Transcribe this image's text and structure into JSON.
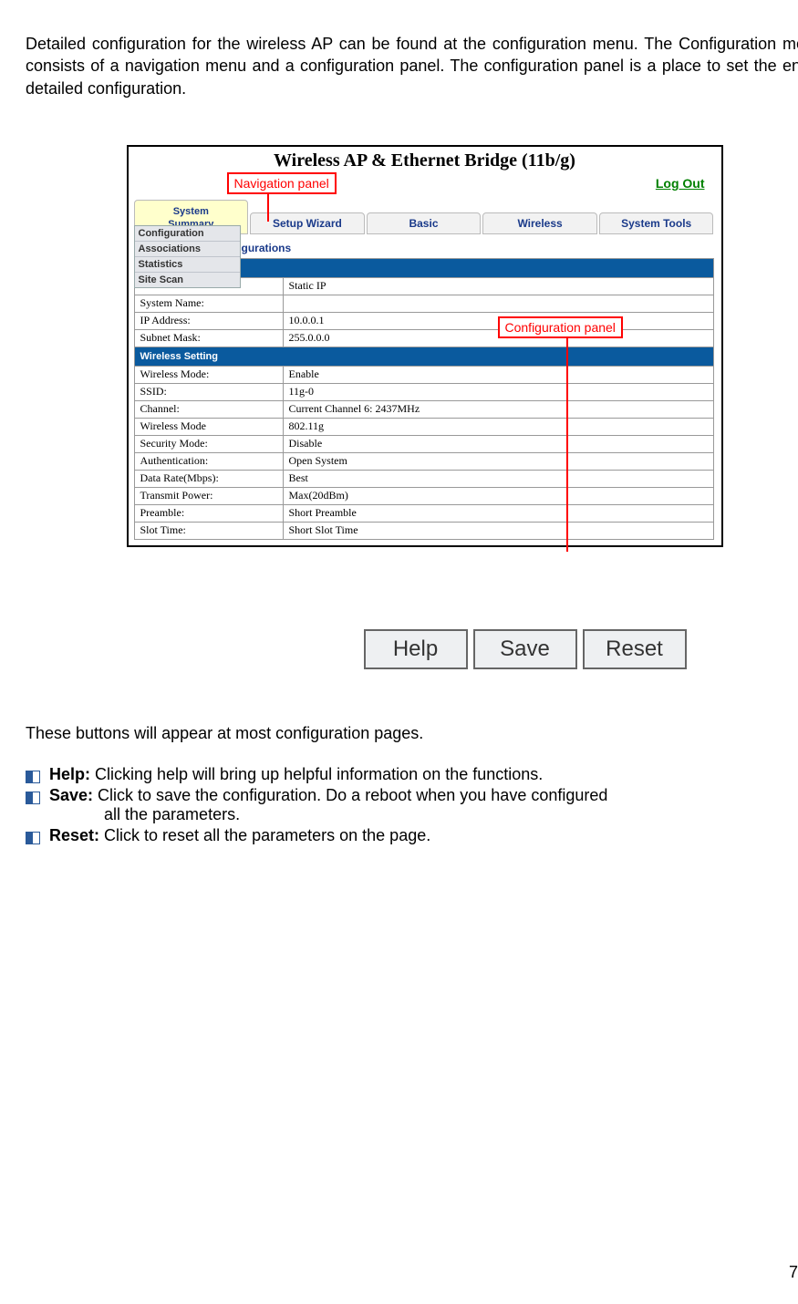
{
  "intro": "Detailed configuration for the wireless AP can be found at the configuration menu. The Configuration menu consists of a navigation menu and a configuration panel. The configuration panel is a place to set the entire detailed configuration.",
  "screenshot": {
    "title": "Wireless AP & Ethernet Bridge (11b/g)",
    "logout": "Log Out",
    "nav_annotation": "Navigation panel",
    "config_annotation": "Configuration panel",
    "tabs": {
      "t0a": "System",
      "t0b": "Summary",
      "t1": "Setup Wizard",
      "t2": "Basic",
      "t3": "Wireless",
      "t4": "System Tools"
    },
    "dropdown": [
      "Configuration",
      "Associations",
      "Statistics",
      "Site Scan"
    ],
    "gurations": "gurations",
    "rows": [
      {
        "type": "header",
        "label": "",
        "value": ""
      },
      {
        "type": "data",
        "label": "",
        "value": "Static IP",
        "extraclass": "first"
      },
      {
        "type": "data",
        "label": "System Name:",
        "value": ""
      },
      {
        "type": "data",
        "label": "IP Address:",
        "value": "10.0.0.1"
      },
      {
        "type": "data",
        "label": "Subnet Mask:",
        "value": "255.0.0.0"
      },
      {
        "type": "header",
        "label": "Wireless Setting",
        "value": ""
      },
      {
        "type": "data",
        "label": "Wireless Mode:",
        "value": "Enable"
      },
      {
        "type": "data",
        "label": "SSID:",
        "value": "11g-0"
      },
      {
        "type": "data",
        "label": "Channel:",
        "value": "Current Channel 6: 2437MHz"
      },
      {
        "type": "data",
        "label": "Wireless Mode",
        "value": "802.11g"
      },
      {
        "type": "data",
        "label": "Security Mode:",
        "value": "Disable"
      },
      {
        "type": "data",
        "label": "Authentication:",
        "value": "Open System"
      },
      {
        "type": "data",
        "label": "Data Rate(Mbps):",
        "value": "Best"
      },
      {
        "type": "data",
        "label": "Transmit Power:",
        "value": "Max(20dBm)"
      },
      {
        "type": "data",
        "label": "Preamble:",
        "value": "Short Preamble"
      },
      {
        "type": "data",
        "label": "Slot Time:",
        "value": "Short Slot Time"
      }
    ]
  },
  "buttons": {
    "help": "Help",
    "save": "Save",
    "reset": "Reset"
  },
  "buttons_intro": "These buttons will appear at most configuration pages.",
  "descs": {
    "help": {
      "label": "Help:",
      "text": " Clicking help will bring up helpful information on the functions."
    },
    "save": {
      "label": "Save:",
      "text": " Click to save the configuration. Do a reboot when you have configured",
      "cont": "all the parameters."
    },
    "reset": {
      "label": "Reset:",
      "text": " Click to reset all the parameters on the page."
    }
  },
  "page_number": "7"
}
